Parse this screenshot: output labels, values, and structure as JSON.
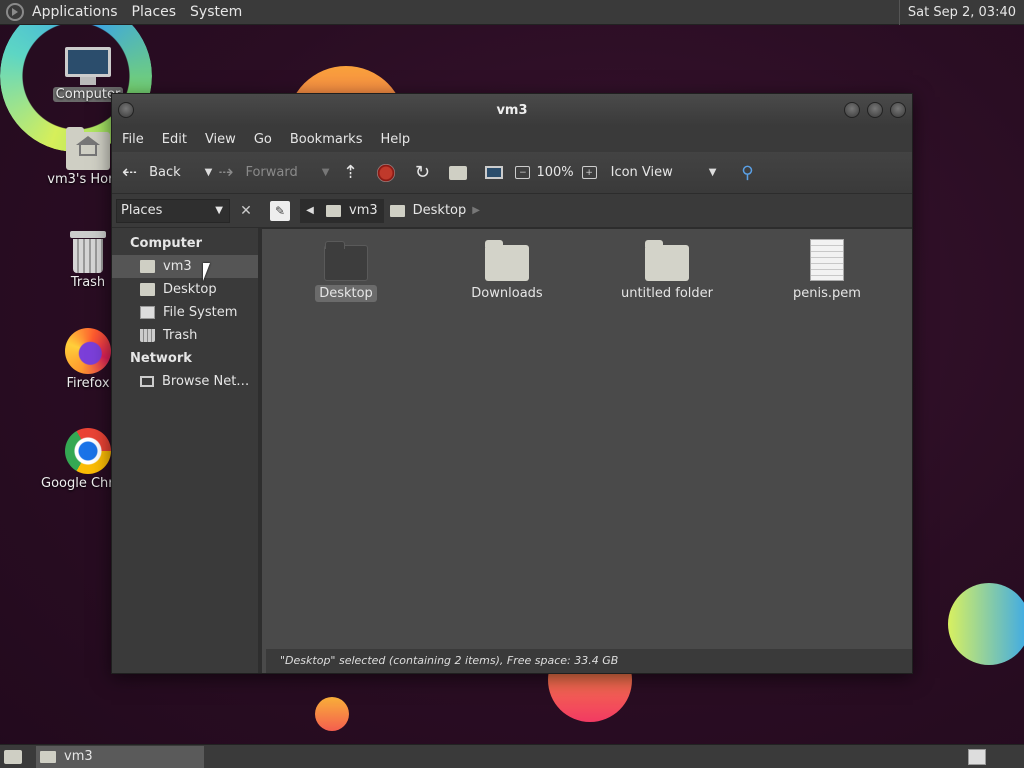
{
  "top_panel": {
    "menus": [
      "Applications",
      "Places",
      "System"
    ],
    "clock": "Sat Sep  2, 03:40"
  },
  "desktop_icons": [
    {
      "label": "Computer",
      "icon": "computer-icon"
    },
    {
      "label": "vm3's Home",
      "icon": "home-folder-icon"
    },
    {
      "label": "Trash",
      "icon": "trash-icon"
    },
    {
      "label": "Firefox",
      "icon": "firefox-icon"
    },
    {
      "label": "Google Chrome",
      "icon": "chrome-icon"
    }
  ],
  "window": {
    "title": "vm3",
    "menus": [
      "File",
      "Edit",
      "View",
      "Go",
      "Bookmarks",
      "Help"
    ],
    "toolbar": {
      "back": "Back",
      "forward": "Forward",
      "zoom": "100%",
      "view_mode": "Icon View"
    },
    "location": {
      "sidebar_select": "Places",
      "crumbs": [
        "vm3",
        "Desktop"
      ]
    },
    "sidebar": {
      "computer_header": "Computer",
      "computer_items": [
        "vm3",
        "Desktop",
        "File System",
        "Trash"
      ],
      "network_header": "Network",
      "network_items": [
        "Browse Net…"
      ]
    },
    "files": [
      {
        "name": "Desktop",
        "type": "folder",
        "selected": true
      },
      {
        "name": "Downloads",
        "type": "folder"
      },
      {
        "name": "untitled folder",
        "type": "folder"
      },
      {
        "name": "penis.pem",
        "type": "file"
      }
    ],
    "status": "\"Desktop\" selected (containing 2 items), Free space: 33.4 GB"
  },
  "taskbar": {
    "task": "vm3"
  }
}
